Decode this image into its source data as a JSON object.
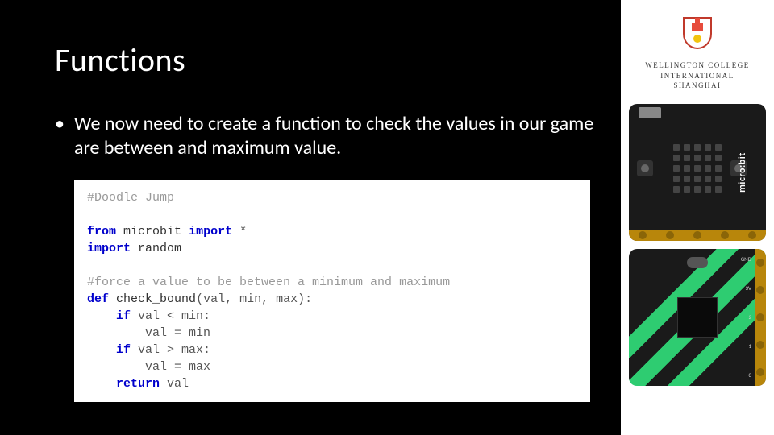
{
  "title": "Functions",
  "bullet": "We now need to create a function to check the values in our game are between and maximum value.",
  "code": {
    "c1": "#Doodle Jump",
    "kw_from": "from",
    "mod1": "microbit",
    "kw_import": "import",
    "star": "*",
    "kw_import2": "import",
    "mod2": "random",
    "c2": "#force a value to be between a minimum and maximum",
    "kw_def": "def",
    "fname": "check_bound",
    "params": "(val, min, max):",
    "kw_if1": "if",
    "cond1": "val < min:",
    "asn1": "val = min",
    "kw_if2": "if",
    "cond2": "val > max:",
    "asn2": "val = max",
    "kw_ret": "return",
    "retv": "val"
  },
  "logo": {
    "line1": "WELLINGTON COLLEGE",
    "line2": "INTERNATIONAL",
    "line3": "SHANGHAI"
  },
  "microbit": {
    "label": "micro:bit",
    "pins": [
      "0",
      "1",
      "2",
      "3V",
      "GND"
    ]
  }
}
